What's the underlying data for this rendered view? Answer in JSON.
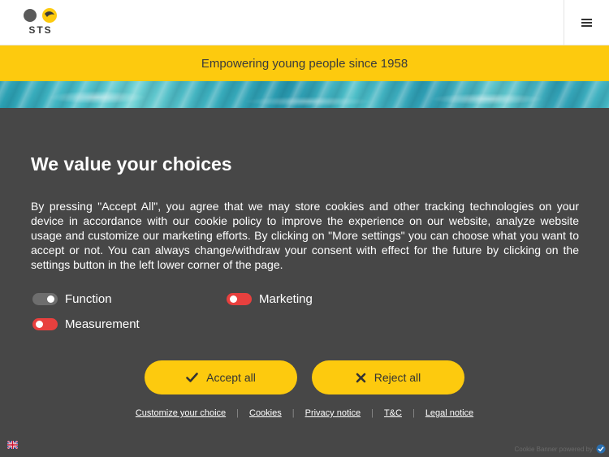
{
  "header": {
    "logo_text": "STS",
    "menu_icon": "hamburger-icon"
  },
  "tagline": "Empowering young people since 1958",
  "cookie_banner": {
    "title": "We value your choices",
    "body": "By pressing \"Accept All\", you agree that we may store cookies and other tracking technologies on your device in accordance with our cookie policy to improve the experience on our website, analyze website usage and customize our marketing efforts. By clicking on \"More settings\" you can choose what you want to accept or not. You can always change/withdraw your consent with effect for the future by clicking on the settings button in the left lower corner of the page.",
    "toggles": [
      {
        "label": "Function",
        "state": "on"
      },
      {
        "label": "Marketing",
        "state": "off"
      },
      {
        "label": "Measurement",
        "state": "off"
      }
    ],
    "accept_label": "Accept all",
    "reject_label": "Reject all",
    "links": [
      "Customize your choice",
      "Cookies",
      "Privacy notice",
      "T&C",
      "Legal notice"
    ],
    "powered_by": "Cookie Banner powered by"
  },
  "colors": {
    "accent": "#fdca0e",
    "overlay": "#474747",
    "toggle_off": "#e8403e",
    "toggle_on": "#6e6e6e"
  }
}
